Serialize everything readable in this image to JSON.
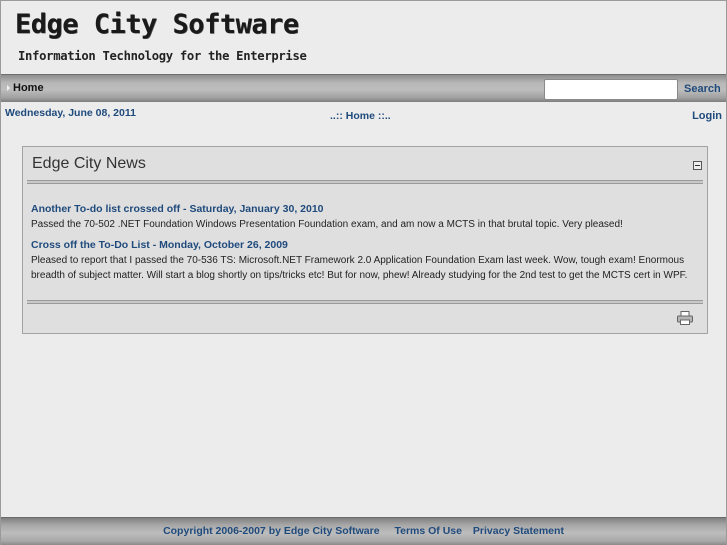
{
  "header": {
    "title": "Edge City Software",
    "tagline": "Information Technology for the Enterprise"
  },
  "nav": {
    "items": [
      {
        "label": "Home",
        "icon": "arrow-right-icon"
      }
    ],
    "search": {
      "value": "",
      "placeholder": "",
      "button_label": "Search"
    }
  },
  "subbar": {
    "date": "Wednesday, June 08, 2011",
    "breadcrumb_prefix": "..::",
    "breadcrumb_current": "Home",
    "breadcrumb_suffix": "::..",
    "login_label": "Login"
  },
  "module": {
    "title": "Edge City News",
    "collapse_icon": "minus-box-icon",
    "print_icon": "printer-icon",
    "items": [
      {
        "title": "Another To-do list crossed off - Saturday, January 30, 2010",
        "body": "Passed the 70-502 .NET Foundation Windows Presentation Foundation exam, and am now a MCTS in that brutal topic. Very pleased!"
      },
      {
        "title": "Cross off the To-Do List - Monday, October 26, 2009",
        "body": "Pleased to report that I passed the 70-536 TS: Microsoft.NET Framework 2.0 Application Foundation Exam last week. Wow, tough exam! Enormous breadth of subject matter. Will start a blog shortly on tips/tricks etc! But for now, phew! Already studying for the 2nd test to get the MCTS cert in WPF."
      }
    ]
  },
  "footer": {
    "copyright": "Copyright 2006-2007 by Edge City Software",
    "terms_label": "Terms Of Use",
    "privacy_label": "Privacy Statement"
  },
  "colors": {
    "link": "#1f4a7c",
    "background": "#ececec",
    "module_background": "#dfdfdf"
  }
}
